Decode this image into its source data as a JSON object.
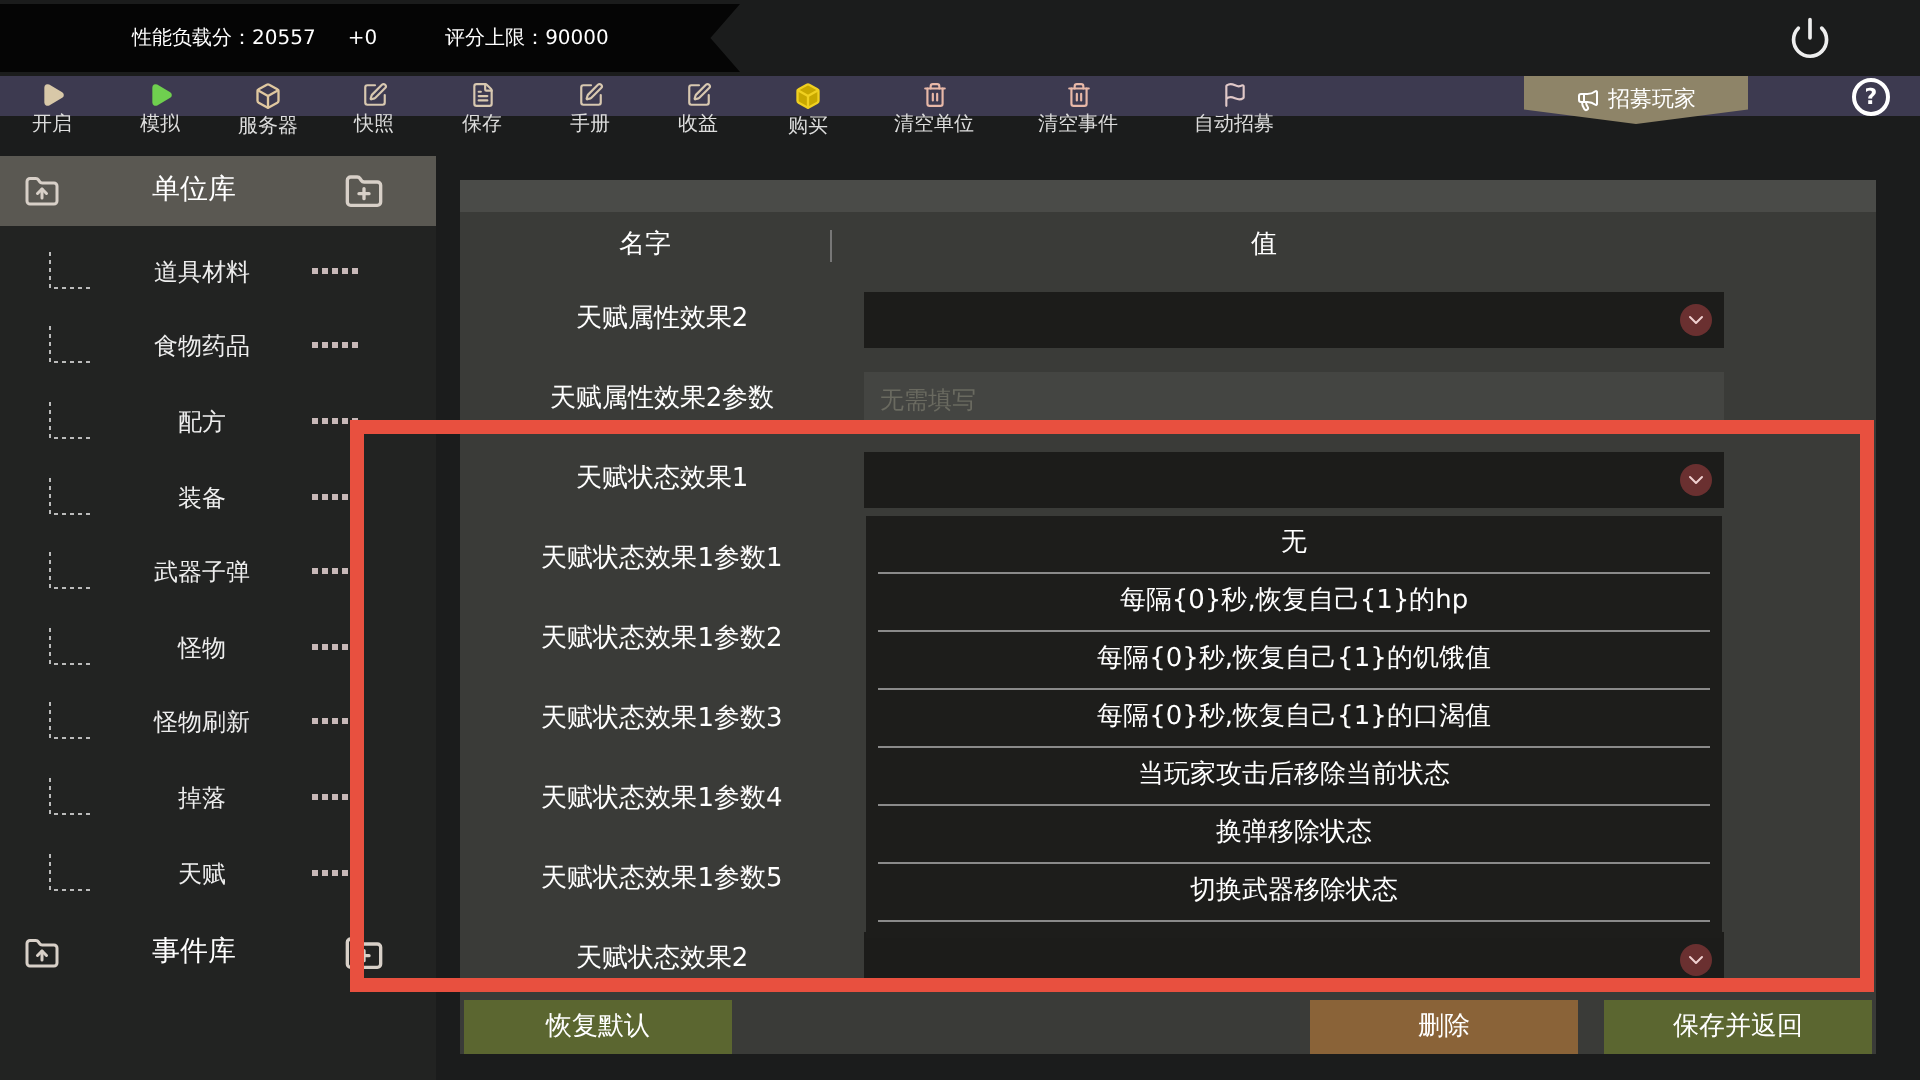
{
  "stats": {
    "load_label": "性能负载分：",
    "load_value": "20557",
    "delta": "+0",
    "limit_label": "评分上限：",
    "limit_value": "90000"
  },
  "toolbar": [
    {
      "label": "开启"
    },
    {
      "label": "模拟"
    },
    {
      "label": "服务器"
    },
    {
      "label": "快照"
    },
    {
      "label": "保存"
    },
    {
      "label": "手册"
    },
    {
      "label": "收益"
    },
    {
      "label": "购买"
    },
    {
      "label": "清空单位"
    },
    {
      "label": "清空事件"
    },
    {
      "label": "自动招募"
    }
  ],
  "recruit_button": "招募玩家",
  "help_button": "?",
  "sidebar": {
    "groups": [
      {
        "title": "单位库",
        "expanded": true,
        "children": [
          {
            "label": "道具材料"
          },
          {
            "label": "食物药品"
          },
          {
            "label": "配方"
          },
          {
            "label": "装备"
          },
          {
            "label": "武器子弹"
          },
          {
            "label": "怪物"
          },
          {
            "label": "怪物刷新"
          },
          {
            "label": "掉落"
          },
          {
            "label": "天赋"
          }
        ]
      },
      {
        "title": "事件库",
        "expanded": false
      }
    ]
  },
  "table": {
    "columns": [
      "名字",
      "值"
    ],
    "rows": [
      {
        "name": "天赋属性效果2",
        "kind": "select"
      },
      {
        "name": "天赋属性效果2参数",
        "kind": "text",
        "placeholder": "无需填写"
      },
      {
        "name": "天赋状态效果1",
        "kind": "select"
      },
      {
        "name": "天赋状态效果1参数1",
        "kind": "covered"
      },
      {
        "name": "天赋状态效果1参数2",
        "kind": "covered"
      },
      {
        "name": "天赋状态效果1参数3",
        "kind": "covered"
      },
      {
        "name": "天赋状态效果1参数4",
        "kind": "covered"
      },
      {
        "name": "天赋状态效果1参数5",
        "kind": "covered"
      },
      {
        "name": "天赋状态效果2",
        "kind": "select"
      }
    ]
  },
  "dropdown": {
    "options": [
      "无",
      "每隔{0}秒,恢复自己{1}的hp",
      "每隔{0}秒,恢复自己{1}的饥饿值",
      "每隔{0}秒,恢复自己{1}的口渴值",
      "当玩家攻击后移除当前状态",
      "换弹移除状态",
      "切换武器移除状态"
    ]
  },
  "buttons": [
    {
      "label": "恢复默认",
      "kind": "neutral"
    },
    {
      "label": "删除",
      "kind": "danger"
    },
    {
      "label": "保存并返回",
      "kind": "neutral"
    }
  ]
}
